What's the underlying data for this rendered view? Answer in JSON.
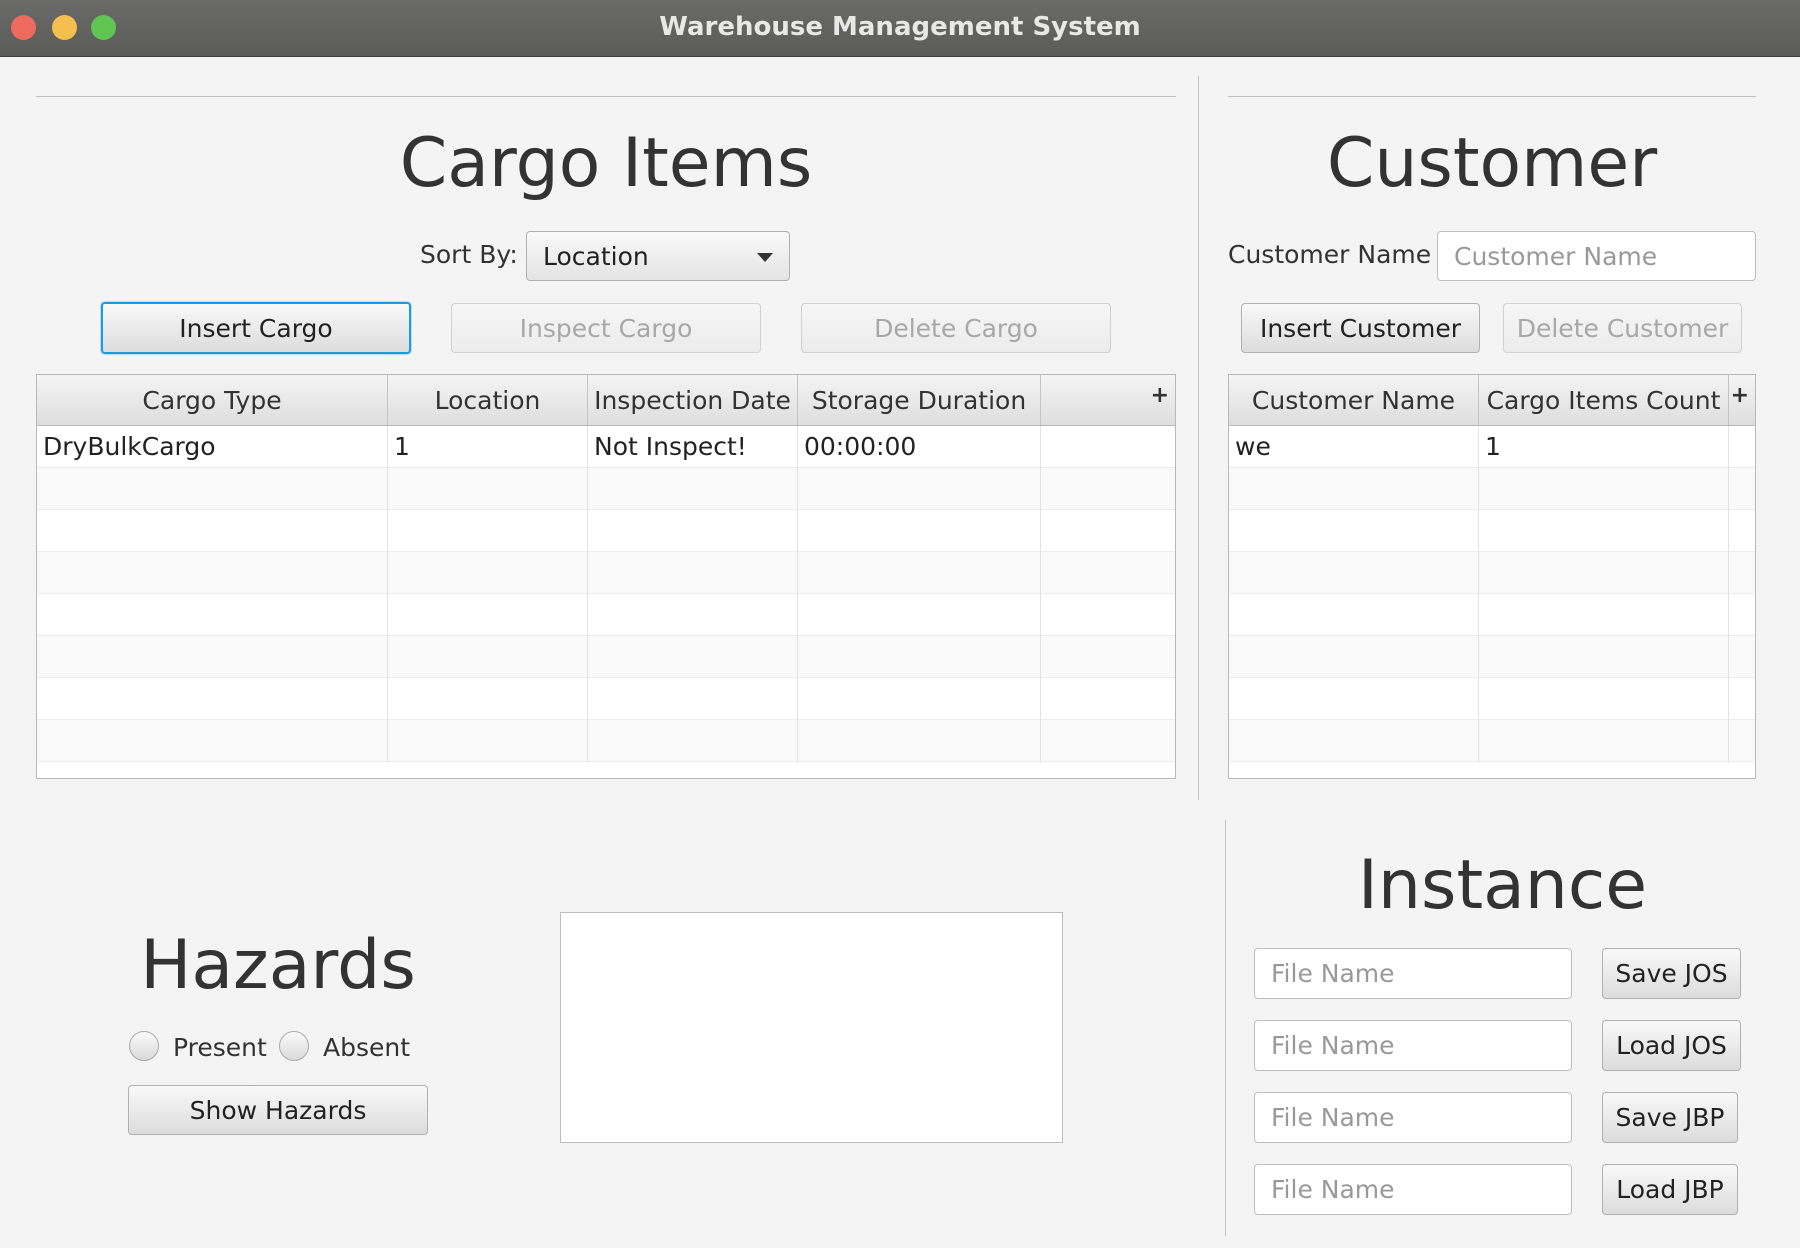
{
  "window": {
    "title": "Warehouse Management System"
  },
  "cargo": {
    "heading": "Cargo Items",
    "sort_label": "Sort By:",
    "sort_value": "Location",
    "insert_label": "Insert Cargo",
    "inspect_label": "Inspect Cargo",
    "delete_label": "Delete Cargo",
    "table": {
      "columns": [
        "Cargo Type",
        "Location",
        "Inspection Date",
        "Storage Duration"
      ],
      "rows": [
        [
          "DryBulkCargo",
          "1",
          "Not Inspect!",
          "00:00:00"
        ]
      ]
    }
  },
  "customer": {
    "heading": "Customer",
    "name_label": "Customer Name",
    "name_placeholder": "Customer Name",
    "insert_label": "Insert Customer",
    "delete_label": "Delete Customer",
    "table": {
      "columns": [
        "Customer Name",
        "Cargo Items Count"
      ],
      "rows": [
        [
          "we",
          "1"
        ]
      ]
    }
  },
  "hazards": {
    "heading": "Hazards",
    "present_label": "Present",
    "absent_label": "Absent",
    "show_label": "Show Hazards"
  },
  "instance": {
    "heading": "Instance",
    "file_placeholder": "File Name",
    "save_jos": "Save JOS",
    "load_jos": "Load JOS",
    "save_jbp": "Save JBP",
    "load_jbp": "Load JBP"
  },
  "icons": {
    "column_menu": "plus-icon"
  }
}
